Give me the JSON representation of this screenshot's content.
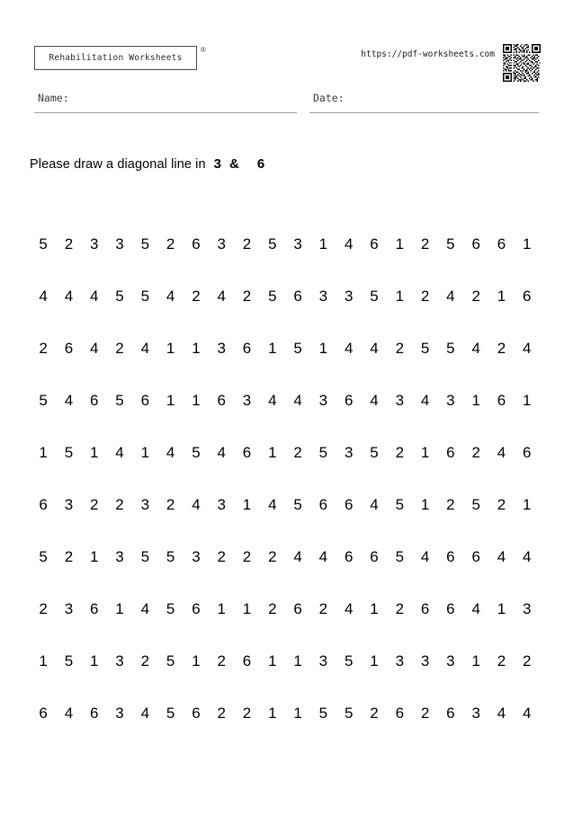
{
  "header": {
    "brand_label": "Rehabilitation Worksheets",
    "registered_mark": "®",
    "url": "https://pdf-worksheets.com",
    "qr_icon": "qr-code-icon"
  },
  "fields": {
    "name_label": "Name:",
    "name_value": "",
    "date_label": "Date:",
    "date_value": ""
  },
  "instruction": {
    "lead": "Please draw a diagonal line in",
    "target_a": "3",
    "separator": "&",
    "target_b": "6"
  },
  "grid": {
    "rows": 10,
    "columns": 20,
    "values": [
      [
        5,
        2,
        3,
        3,
        5,
        2,
        6,
        3,
        2,
        5,
        3,
        1,
        4,
        6,
        1,
        2,
        5,
        6,
        6,
        1
      ],
      [
        4,
        4,
        4,
        5,
        5,
        4,
        2,
        4,
        2,
        5,
        6,
        3,
        3,
        5,
        1,
        2,
        4,
        2,
        1,
        6
      ],
      [
        2,
        6,
        4,
        2,
        4,
        1,
        1,
        3,
        6,
        1,
        5,
        1,
        4,
        4,
        2,
        5,
        5,
        4,
        2,
        4
      ],
      [
        5,
        4,
        6,
        5,
        6,
        1,
        1,
        6,
        3,
        4,
        4,
        3,
        6,
        4,
        3,
        4,
        3,
        1,
        6,
        1
      ],
      [
        1,
        5,
        1,
        4,
        1,
        4,
        5,
        4,
        6,
        1,
        2,
        5,
        3,
        5,
        2,
        1,
        6,
        2,
        4,
        6
      ],
      [
        6,
        3,
        2,
        2,
        3,
        2,
        4,
        3,
        1,
        4,
        5,
        6,
        6,
        4,
        5,
        1,
        2,
        5,
        2,
        1
      ],
      [
        5,
        2,
        1,
        3,
        5,
        5,
        3,
        2,
        2,
        2,
        4,
        4,
        6,
        6,
        5,
        4,
        6,
        6,
        4,
        4
      ],
      [
        2,
        3,
        6,
        1,
        4,
        5,
        6,
        1,
        1,
        2,
        6,
        2,
        4,
        1,
        2,
        6,
        6,
        4,
        1,
        3
      ],
      [
        1,
        5,
        1,
        3,
        2,
        5,
        1,
        2,
        6,
        1,
        1,
        3,
        5,
        1,
        3,
        3,
        3,
        1,
        2,
        2
      ],
      [
        6,
        4,
        6,
        3,
        4,
        5,
        6,
        2,
        2,
        1,
        1,
        5,
        5,
        2,
        6,
        2,
        6,
        3,
        4,
        4
      ]
    ]
  },
  "colors": {
    "text": "#000000",
    "muted_text": "#3a3a3a",
    "rule": "#9a9a9a",
    "box_border": "#4a4a4a",
    "background": "#ffffff"
  }
}
